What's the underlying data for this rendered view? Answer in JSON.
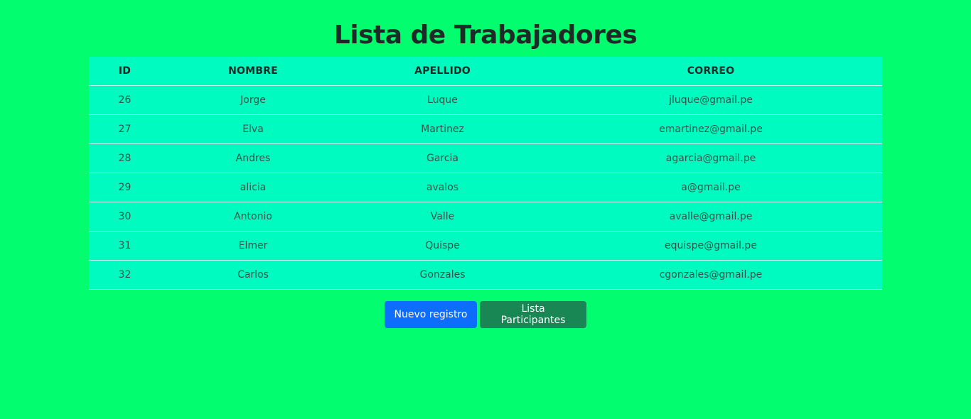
{
  "page": {
    "title": "Lista de Trabajadores",
    "background_color": "#02fd6f"
  },
  "table": {
    "headers": [
      "ID",
      "NOMBRE",
      "APELLIDO",
      "CORREO"
    ],
    "row_color": "#00fbc0",
    "rows": [
      {
        "id": "26",
        "nombre": "Jorge",
        "apellido": "Luque",
        "correo": "jluque@gmail.pe"
      },
      {
        "id": "27",
        "nombre": "Elva",
        "apellido": "Martinez",
        "correo": "emartinez@gmail.pe"
      },
      {
        "id": "28",
        "nombre": "Andres",
        "apellido": "Garcia",
        "correo": "agarcia@gmail.pe"
      },
      {
        "id": "29",
        "nombre": "alicia",
        "apellido": "avalos",
        "correo": "a@gmail.pe"
      },
      {
        "id": "30",
        "nombre": "Antonio",
        "apellido": "Valle",
        "correo": "avalle@gmail.pe"
      },
      {
        "id": "31",
        "nombre": "Elmer",
        "apellido": "Quispe",
        "correo": "equispe@gmail.pe"
      },
      {
        "id": "32",
        "nombre": "Carlos",
        "apellido": "Gonzales",
        "correo": "cgonzales@gmail.pe"
      }
    ]
  },
  "actions": {
    "new_record_label": "Nuevo registro",
    "new_record_color": "#0d6efd",
    "participants_label": "Lista Participantes",
    "participants_color": "#198754"
  }
}
